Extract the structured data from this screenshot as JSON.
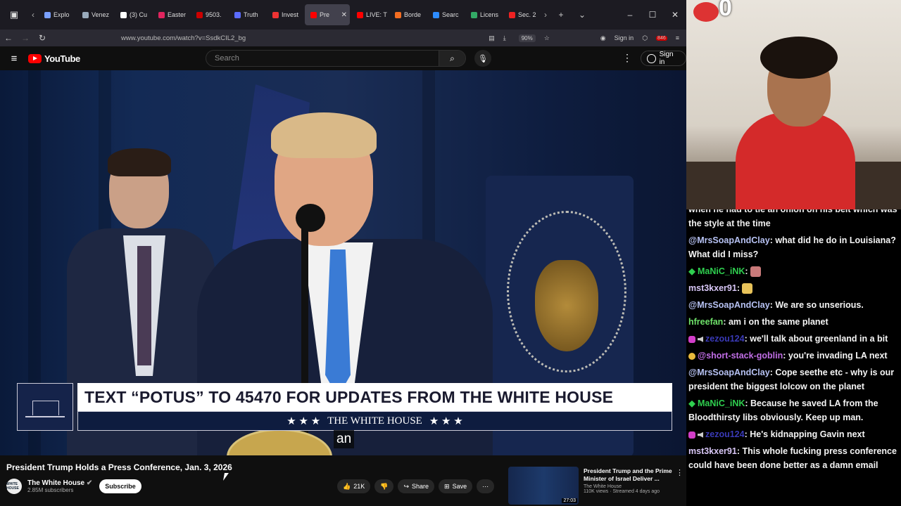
{
  "browser": {
    "tabs": [
      {
        "label": "Explo",
        "color": "#7aa0ff"
      },
      {
        "label": "Venez",
        "color": "#9ab"
      },
      {
        "label": "(3) Cu",
        "color": "#ffffff"
      },
      {
        "label": "Easter",
        "color": "#e0245e"
      },
      {
        "label": "9503.",
        "color": "#c00"
      },
      {
        "label": "Truth",
        "color": "#5b6cff"
      },
      {
        "label": "Invest",
        "color": "#e33"
      },
      {
        "label": "Pre",
        "color": "#f00",
        "active": true
      },
      {
        "label": "LIVE: T",
        "color": "#f00"
      },
      {
        "label": "Borde",
        "color": "#f36d21"
      },
      {
        "label": "Searc",
        "color": "#2d8cff"
      },
      {
        "label": "Licens",
        "color": "#3a6"
      },
      {
        "label": "Sec. 2",
        "color": "#e22"
      }
    ],
    "url": "www.youtube.com/watch?v=SsdkCIL2_bg",
    "zoom": "90%",
    "sign_in": "Sign in",
    "ext_badge": "846"
  },
  "youtube": {
    "logo_text": "YouTube",
    "search_placeholder": "Search",
    "sign_in": "Sign in"
  },
  "video": {
    "lower_third_main": "TEXT “POTUS” TO 45470 FOR UPDATES FROM THE WHITE HOUSE",
    "lower_third_sub": "THE WHITE HOUSE",
    "stars": "★ ★ ★",
    "caption": "an",
    "logo_text": "WHITE HOUSE",
    "title": "President Trump Holds a Press Conference, Jan. 3, 2026",
    "channel": "The White House",
    "subscribers": "2.85M subscribers",
    "subscribe": "Subscribe",
    "likes": "21K",
    "share": "Share",
    "save": "Save"
  },
  "recommendation": {
    "title": "President Trump and the Prime Minister of Israel Deliver ...",
    "channel": "The White House",
    "meta": "110K views · Streamed 4 days ago",
    "duration": "27:03"
  },
  "stream": {
    "viewer_count": "0"
  },
  "chat": {
    "cut_line": "when he had to tie an onion on his belt which was the style at the time",
    "messages": [
      {
        "user": "@MrsSoapAndClay",
        "color": "#b6c1f2",
        "badges": [],
        "text": ": what did he do in Louisiana? What did I miss?"
      },
      {
        "user": "MaNiC_iNK",
        "color": "#2fcf4f",
        "badges": [
          "diamond"
        ],
        "text": ": ",
        "emote": "#c97a7a"
      },
      {
        "user": "mst3kxer91",
        "color": "#d9c7f7",
        "badges": [],
        "text": ": ",
        "emote": "#e8c35a"
      },
      {
        "user": "@MrsSoapAndClay",
        "color": "#b6c1f2",
        "badges": [],
        "text": ": We are so unserious."
      },
      {
        "user": "hfreefan",
        "color": "#6fe26a",
        "badges": [],
        "text": ": am i on the same planet"
      },
      {
        "user": "zezou124",
        "color": "#3a3ab8",
        "badges": [
          "heart",
          "mute"
        ],
        "text": ": we'll talk about greenland in a bit"
      },
      {
        "user": "@short-stack-goblin",
        "color": "#c16ee6",
        "badges": [
          "coin"
        ],
        "text": ": you're invading LA next"
      },
      {
        "user": "@MrsSoapAndClay",
        "color": "#b6c1f2",
        "badges": [],
        "text": ": Cope seethe etc - why is our president the biggest lolcow on the planet"
      },
      {
        "user": "MaNiC_iNK",
        "color": "#2fcf4f",
        "badges": [
          "diamond"
        ],
        "text": ": Because he saved LA from the Bloodthirsty libs obviously. Keep up man."
      },
      {
        "user": "zezou124",
        "color": "#3a3ab8",
        "badges": [
          "heart",
          "mute"
        ],
        "text": ": He's kidnapping Gavin next"
      },
      {
        "user": "mst3kxer91",
        "color": "#d9c7f7",
        "badges": [],
        "text": ": This whole fucking press conference could have been done better as a damn email"
      }
    ]
  }
}
